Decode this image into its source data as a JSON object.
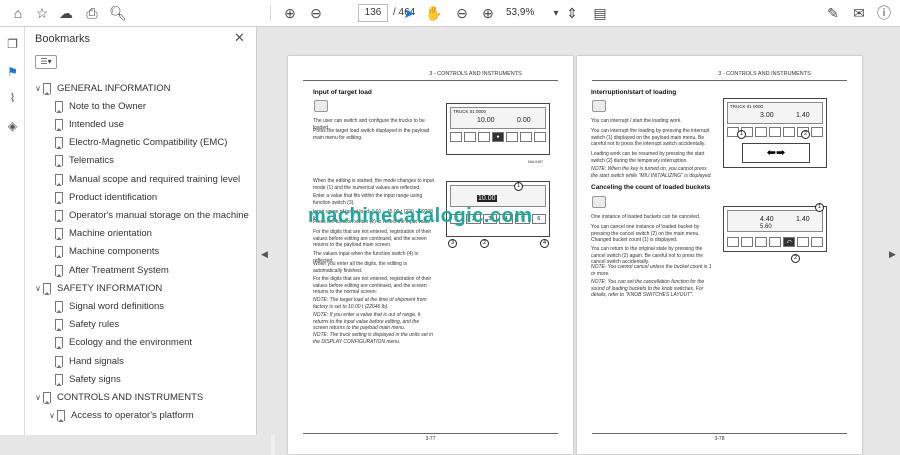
{
  "toolbar": {
    "page_current": "136",
    "page_total": "/ 464",
    "zoom": "53,9%"
  },
  "panel": {
    "title": "Bookmarks",
    "close_glyph": "✕"
  },
  "bookmarks": [
    {
      "label": "GENERAL INFORMATION",
      "level": 0,
      "expanded": true
    },
    {
      "label": "Note to the Owner",
      "level": 1
    },
    {
      "label": "Intended use",
      "level": 1
    },
    {
      "label": "Electro-Magnetic Compatibility (EMC)",
      "level": 1
    },
    {
      "label": "Telematics",
      "level": 1
    },
    {
      "label": "Manual scope and required training level",
      "level": 1
    },
    {
      "label": "Product identification",
      "level": 1
    },
    {
      "label": "Operator's manual storage on the machine",
      "level": 1
    },
    {
      "label": "Machine orientation",
      "level": 1
    },
    {
      "label": "Machine components",
      "level": 1
    },
    {
      "label": "After Treatment System",
      "level": 1
    },
    {
      "label": "SAFETY INFORMATION",
      "level": 0,
      "expanded": true
    },
    {
      "label": "Signal word definitions",
      "level": 1
    },
    {
      "label": "Safety rules",
      "level": 1
    },
    {
      "label": "Ecology and the environment",
      "level": 1
    },
    {
      "label": "Hand signals",
      "level": 1
    },
    {
      "label": "Safety signs",
      "level": 1
    },
    {
      "label": "CONTROLS AND INSTRUMENTS",
      "level": 0,
      "expanded": true
    },
    {
      "label": "Access to operator's platform",
      "level": 1,
      "expanded": true
    }
  ],
  "left_page": {
    "header": "3 - CONTROLS AND INSTRUMENTS",
    "heading": "Input of target load",
    "p1": "The user can switch and configure the trucks to be loaded.",
    "p2": "Press the target load switch displayed in the payload main menu for editing.",
    "p3": "When the editing is started, the mode changes to input mode (1) and the numerical values are reflected.",
    "p4": "Enter a value that fits within the input range using function switch (3).",
    "p5": "Input range of target load: 0.01 – 45.00 t (220 – 99208 lb)",
    "p6": "Press the function switch (2) to reflect the input value.",
    "p7": "For the digits that are not entered, registration of their values before editing are continued, and the screen returns to the payload main screen.",
    "p8": "The values input when the function switch (4) is reflected.",
    "p9": "When you enter all the digits, the editing is automatically finished.",
    "p10": "For the digits that are not entered, registration of their values before editing are continued, and the screen returns to the normal screen:",
    "note1": "NOTE: The target load at the time of shipment from factory is set to 10.00 t (22046 lb).",
    "note2": "NOTE: If you enter a value that is out of range, it returns to the input value before editing, and the screen returns to the payload main menu.",
    "note3": "NOTE: The truck setting is displayed in the units set in the DISPLAY CONFIGURATION menu.",
    "lcd1_top": "TRUCK 01  0000",
    "lcd1_val": "10.00",
    "lcd1_right": "0.00",
    "lcd2_val": "10.00",
    "lcd2_keys": [
      "1",
      "2",
      "3",
      "4",
      "5",
      "6"
    ],
    "fig1_ref": "MAL0487",
    "page_num": "3-77"
  },
  "right_page": {
    "header": "3 - CONTROLS AND INSTRUMENTS",
    "heading1": "Interruption/start of loading",
    "r1": "You can interrupt / start the loading work.",
    "r2": "You can interrupt the loading by pressing the interrupt switch (1) displayed on the payload main menu. Be careful not to press the interrupt switch accidentally.",
    "r3": "Loading work can be resumed by pressing the start switch (2) during the temporary interruption.",
    "note1": "NOTE: When the key is turned on, you cannot press the start switch while \"MIU INITIALIZING\" is displayed.",
    "heading2": "Canceling the count of loaded buckets",
    "r4": "One instance of loaded buckets can be canceled.",
    "r5": "You can cancel one instance of loaded bucket by pressing the cancel switch (2) on the main menu. Changed bucket count (1) is displayed.",
    "r6": "You can return to the original state by pressing the cancel switch (2) again. Be careful not to press the cancel switch accidentally.",
    "note2": "NOTE: You cannot cancel unless the bucket count is 1 or more.",
    "note3": "NOTE: You can set the cancellation function for the sound of loading buckets to the knob switches. For details, refer to \"KNOB SWITCHES LAYOUT\".",
    "lcd1_top": "TRUCK 01  0000",
    "lcd1_val": "3.00",
    "lcd1_right": "1.40",
    "lcd2_val": "4.40",
    "lcd2_sub": "5.60",
    "lcd2_right": "1.40",
    "page_num": "3-78"
  },
  "watermark": "machinecatalogic.com"
}
